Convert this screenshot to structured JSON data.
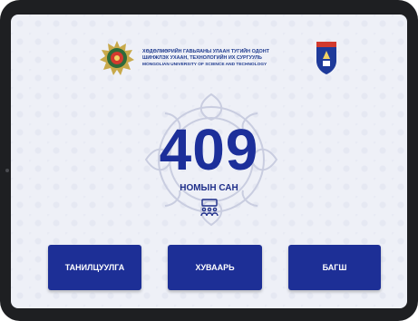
{
  "header": {
    "university_line1": "ХӨДӨЛМӨРИЙН ГАВЬЯАНЫ УЛААН ТУГИЙН ОДОНТ",
    "university_line2": "ШИНЖЛЭХ УХААН, ТЕХНОЛОГИЙН ИХ СУРГУУЛЬ",
    "university_en": "MONGOLIAN UNIVERSITY OF SCIENCE AND TECHNOLOGY",
    "left_logo_icon": "university-emblem-icon",
    "right_logo_icon": "shield-badge-icon"
  },
  "room": {
    "number": "409",
    "label": "НОМЫН САН",
    "icon": "library-seating-icon"
  },
  "buttons": {
    "intro": "ТАНИЛЦУУЛГА",
    "schedule": "ХУВААРЬ",
    "teacher": "БАГШ"
  },
  "colors": {
    "primary": "#1d2f96",
    "background": "#eef0f7",
    "frame": "#1e1f22"
  }
}
